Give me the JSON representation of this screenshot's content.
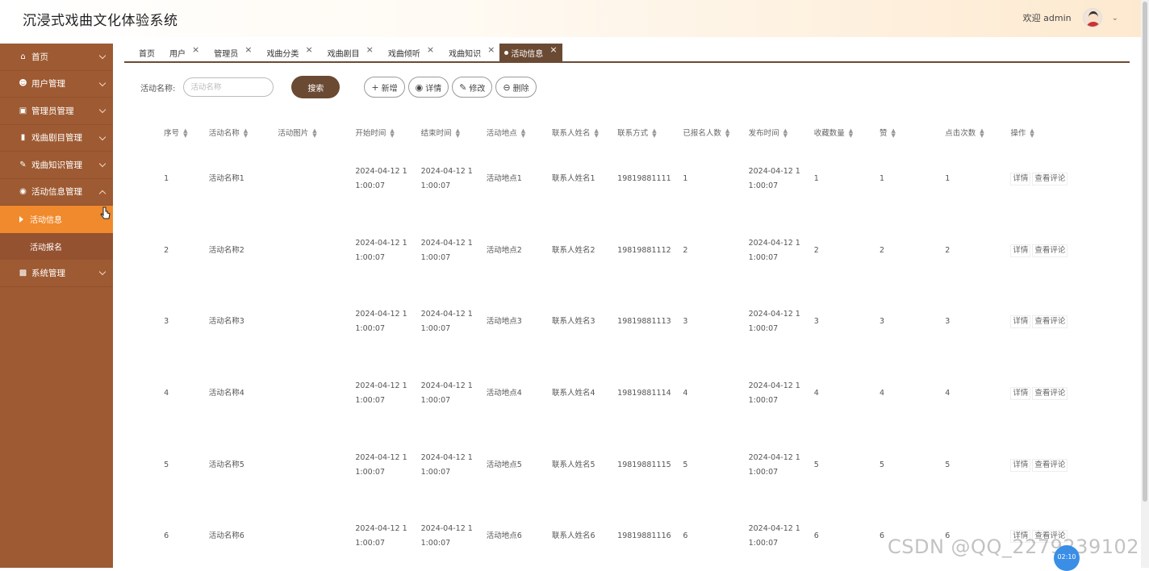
{
  "app": {
    "title": "沉浸式戏曲文化体验系统",
    "welcome": "欢迎 admin"
  },
  "sidebar": {
    "items": [
      {
        "label": "首页",
        "icon": "home-icon"
      },
      {
        "label": "用户管理",
        "icon": "user-icon"
      },
      {
        "label": "管理员管理",
        "icon": "briefcase-icon"
      },
      {
        "label": "戏曲剧目管理",
        "icon": "book-icon"
      },
      {
        "label": "戏曲知识管理",
        "icon": "edit-icon"
      },
      {
        "label": "活动信息管理",
        "icon": "compass-icon"
      },
      {
        "label": "系统管理",
        "icon": "chart-icon"
      }
    ],
    "subitems": [
      {
        "label": "活动信息"
      },
      {
        "label": "活动报名"
      }
    ]
  },
  "tabs": [
    {
      "label": "首页"
    },
    {
      "label": "用户"
    },
    {
      "label": "管理员"
    },
    {
      "label": "戏曲分类"
    },
    {
      "label": "戏曲剧目"
    },
    {
      "label": "戏曲倾听"
    },
    {
      "label": "戏曲知识"
    },
    {
      "label": "活动信息"
    }
  ],
  "toolbar": {
    "search_label": "活动名称:",
    "search_placeholder": "活动名称",
    "search_button": "搜索",
    "add_button": "新增",
    "detail_button": "详情",
    "edit_button": "修改",
    "delete_button": "删除"
  },
  "table": {
    "headers": [
      "序号",
      "活动名称",
      "活动图片",
      "开始时间",
      "结束时间",
      "活动地点",
      "联系人姓名",
      "联系方式",
      "已报名人数",
      "发布时间",
      "收藏数量",
      "赞",
      "点击次数",
      "操作"
    ],
    "op_detail": "详情",
    "op_comments": "查看评论",
    "rows": [
      {
        "idx": "1",
        "name": "活动名称1",
        "start1": "2024-04-12 1",
        "start2": "1:00:07",
        "end1": "2024-04-12 1",
        "end2": "1:00:07",
        "place": "活动地点1",
        "contact": "联系人姓名1",
        "phone": "19819881111",
        "enrolled": "1",
        "pub1": "2024-04-12 1",
        "pub2": "1:00:07",
        "fav": "1",
        "likes": "1",
        "clicks": "1"
      },
      {
        "idx": "2",
        "name": "活动名称2",
        "start1": "2024-04-12 1",
        "start2": "1:00:07",
        "end1": "2024-04-12 1",
        "end2": "1:00:07",
        "place": "活动地点2",
        "contact": "联系人姓名2",
        "phone": "19819881112",
        "enrolled": "2",
        "pub1": "2024-04-12 1",
        "pub2": "1:00:07",
        "fav": "2",
        "likes": "2",
        "clicks": "2"
      },
      {
        "idx": "3",
        "name": "活动名称3",
        "start1": "2024-04-12 1",
        "start2": "1:00:07",
        "end1": "2024-04-12 1",
        "end2": "1:00:07",
        "place": "活动地点3",
        "contact": "联系人姓名3",
        "phone": "19819881113",
        "enrolled": "3",
        "pub1": "2024-04-12 1",
        "pub2": "1:00:07",
        "fav": "3",
        "likes": "3",
        "clicks": "3"
      },
      {
        "idx": "4",
        "name": "活动名称4",
        "start1": "2024-04-12 1",
        "start2": "1:00:07",
        "end1": "2024-04-12 1",
        "end2": "1:00:07",
        "place": "活动地点4",
        "contact": "联系人姓名4",
        "phone": "19819881114",
        "enrolled": "4",
        "pub1": "2024-04-12 1",
        "pub2": "1:00:07",
        "fav": "4",
        "likes": "4",
        "clicks": "4"
      },
      {
        "idx": "5",
        "name": "活动名称5",
        "start1": "2024-04-12 1",
        "start2": "1:00:07",
        "end1": "2024-04-12 1",
        "end2": "1:00:07",
        "place": "活动地点5",
        "contact": "联系人姓名5",
        "phone": "19819881115",
        "enrolled": "5",
        "pub1": "2024-04-12 1",
        "pub2": "1:00:07",
        "fav": "5",
        "likes": "5",
        "clicks": "5"
      },
      {
        "idx": "6",
        "name": "活动名称6",
        "start1": "2024-04-12 1",
        "start2": "1:00:07",
        "end1": "2024-04-12 1",
        "end2": "1:00:07",
        "place": "活动地点6",
        "contact": "联系人姓名6",
        "phone": "19819881116",
        "enrolled": "6",
        "pub1": "2024-04-12 1",
        "pub2": "1:00:07",
        "fav": "6",
        "likes": "6",
        "clicks": "6"
      }
    ]
  },
  "watermark": "CSDN @QQ_2279239102",
  "clock": "02:10",
  "colors": {
    "sidebar": "#9e5a32",
    "active": "#f08a2c",
    "primary": "#6b4a33"
  }
}
